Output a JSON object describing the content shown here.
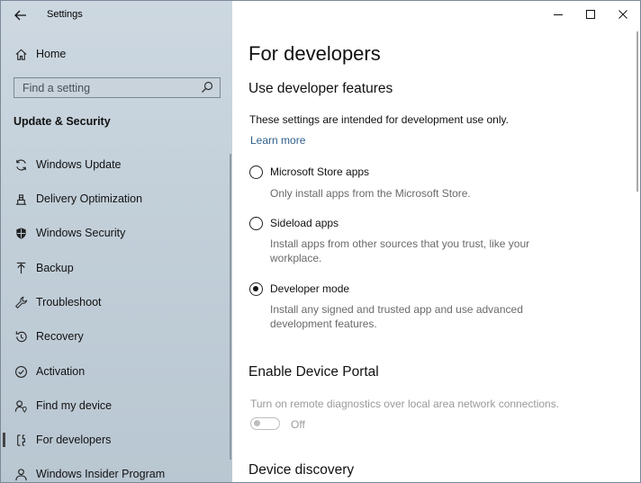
{
  "window": {
    "app_title": "Settings"
  },
  "sidebar": {
    "home_label": "Home",
    "search_placeholder": "Find a setting",
    "section_title": "Update & Security",
    "items": [
      {
        "label": "Windows Update",
        "icon": "sync-icon"
      },
      {
        "label": "Delivery Optimization",
        "icon": "delivery-optimization-icon"
      },
      {
        "label": "Windows Security",
        "icon": "shield-icon"
      },
      {
        "label": "Backup",
        "icon": "backup-icon"
      },
      {
        "label": "Troubleshoot",
        "icon": "wrench-icon"
      },
      {
        "label": "Recovery",
        "icon": "recovery-icon"
      },
      {
        "label": "Activation",
        "icon": "check-circle-icon"
      },
      {
        "label": "Find my device",
        "icon": "person-location-icon"
      },
      {
        "label": "For developers",
        "icon": "developer-icon",
        "selected": true
      },
      {
        "label": "Windows Insider Program",
        "icon": "insider-icon"
      }
    ]
  },
  "main": {
    "page_title": "For developers",
    "use_dev_features": {
      "heading": "Use developer features",
      "description": "These settings are intended for development use only.",
      "learn_more": "Learn more",
      "options": [
        {
          "label": "Microsoft Store apps",
          "description": "Only install apps from the Microsoft Store.",
          "checked": false
        },
        {
          "label": "Sideload apps",
          "description": "Install apps from other sources that you trust, like your workplace.",
          "checked": false
        },
        {
          "label": "Developer mode",
          "description": "Install any signed and trusted app and use advanced development features.",
          "checked": true
        }
      ]
    },
    "device_portal": {
      "heading": "Enable Device Portal",
      "description": "Turn on remote diagnostics over local area network connections.",
      "toggle_state": "Off"
    },
    "device_discovery": {
      "heading": "Device discovery"
    }
  },
  "colors": {
    "sidebar_bg": "#c3d0da",
    "link": "#2f5e8a",
    "muted_text": "#9a9a9a"
  }
}
